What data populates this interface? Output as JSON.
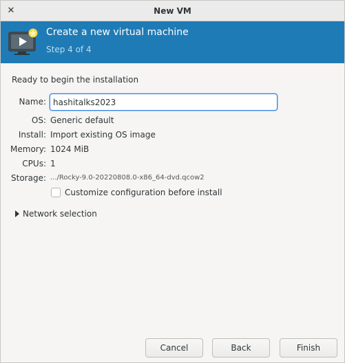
{
  "window": {
    "title": "New VM",
    "close_icon": "close-icon"
  },
  "header": {
    "title": "Create a new virtual machine",
    "step": "Step 4 of 4",
    "icon": "vm-monitor-icon"
  },
  "content": {
    "ready_label": "Ready to begin the installation",
    "name_label": "Name:",
    "name_value": "hashitalks2023",
    "os_label": "OS:",
    "os_value": "Generic default",
    "install_label": "Install:",
    "install_value": "Import existing OS image",
    "memory_label": "Memory:",
    "memory_value": "1024 MiB",
    "cpus_label": "CPUs:",
    "cpus_value": "1",
    "storage_label": "Storage:",
    "storage_value": ".../Rocky-9.0-20220808.0-x86_64-dvd.qcow2",
    "customize_label": "Customize configuration before install",
    "customize_checked": false,
    "network_label": "Network selection"
  },
  "buttons": {
    "cancel": "Cancel",
    "back": "Back",
    "finish": "Finish"
  },
  "colors": {
    "banner": "#1f7bb5",
    "focus": "#3584e4"
  }
}
